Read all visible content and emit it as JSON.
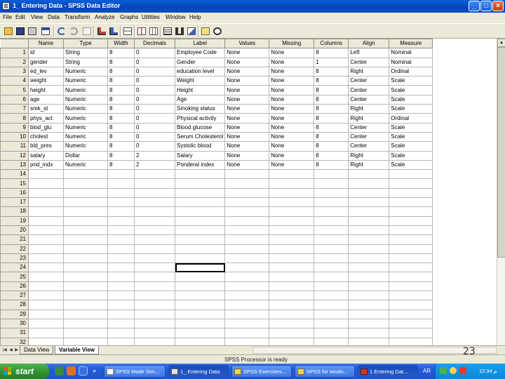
{
  "window": {
    "title": "1_ Entering Data - SPSS Data Editor",
    "minimize": "_",
    "maximize": "□",
    "close": "×"
  },
  "menu": [
    "File",
    "Edit",
    "View",
    "Data",
    "Transform",
    "Analyze",
    "Graphs",
    "Utilities",
    "Window",
    "Help"
  ],
  "toolbar_icons": [
    "open-icon",
    "save-icon",
    "print-icon",
    "dialog-recall-icon",
    "undo-icon",
    "redo-icon",
    "goto-case-icon",
    "variables-icon",
    "find-icon",
    "insert-case-icon",
    "insert-variable-icon",
    "split-file-icon",
    "weight-cases-icon",
    "select-cases-icon",
    "value-labels-icon",
    "use-sets-icon"
  ],
  "grid": {
    "columns": [
      "Name",
      "Type",
      "Width",
      "Decimals",
      "Label",
      "Values",
      "Missing",
      "Columns",
      "Align",
      "Measure"
    ],
    "rows": [
      [
        "id",
        "String",
        "8",
        "0",
        "Employee Code",
        "None",
        "None",
        "8",
        "Left",
        "Nominal"
      ],
      [
        "gender",
        "String",
        "8",
        "0",
        "Gender",
        "None",
        "None",
        "1",
        "Center",
        "Nominal"
      ],
      [
        "ed_lev",
        "Numeric",
        "8",
        "0",
        "education level",
        "None",
        "None",
        "8",
        "Right",
        "Ordinal"
      ],
      [
        "weight",
        "Numeric",
        "8",
        "0",
        "Weight",
        "None",
        "None",
        "8",
        "Center",
        "Scale"
      ],
      [
        "height",
        "Numeric",
        "8",
        "0",
        "Height",
        "None",
        "None",
        "8",
        "Center",
        "Scale"
      ],
      [
        "age",
        "Numeric",
        "8",
        "0",
        "Age",
        "None",
        "None",
        "8",
        "Center",
        "Scale"
      ],
      [
        "smk_st",
        "Numeric",
        "8",
        "0",
        "Smoking status",
        "None",
        "None",
        "8",
        "Right",
        "Scale"
      ],
      [
        "phys_act",
        "Numeric",
        "8",
        "0",
        "Physical activity",
        "None",
        "None",
        "8",
        "Right",
        "Ordinal"
      ],
      [
        "blod_glu",
        "Numeric",
        "8",
        "0",
        "Blood glucose",
        "None",
        "None",
        "8",
        "Center",
        "Scale"
      ],
      [
        "cholest",
        "Numeric",
        "8",
        "0",
        "Serum Cholesterol",
        "None",
        "None",
        "8",
        "Center",
        "Scale"
      ],
      [
        "bld_pres",
        "Numeric",
        "8",
        "0",
        "Systolic blood",
        "None",
        "None",
        "8",
        "Center",
        "Scale"
      ],
      [
        "salary",
        "Dollar",
        "8",
        "2",
        "Salary",
        "None",
        "None",
        "8",
        "Right",
        "Scale"
      ],
      [
        "pnd_indx",
        "Numeric",
        "8",
        "2",
        "Ponderal index",
        "None",
        "None",
        "8",
        "Right",
        "Scale"
      ]
    ],
    "row_numbers": [
      "1",
      "2",
      "3",
      "4",
      "5",
      "6",
      "7",
      "8",
      "9",
      "10",
      "11",
      "12",
      "13",
      "14",
      "15",
      "16",
      "17",
      "18",
      "19",
      "20",
      "21",
      "22",
      "23",
      "24",
      "25",
      "26",
      "27",
      "28",
      "29",
      "30",
      "31",
      "32"
    ]
  },
  "tabs": {
    "data_view": "Data View",
    "variable_view": "Variable View"
  },
  "status": "SPSS Processor  is ready",
  "page_number": "23",
  "taskbar": {
    "start": "start",
    "more": "»",
    "buttons": [
      "SPSS Made Sim...",
      "1_ Entering Data",
      "SPSS Exercises...",
      "SPSS for windo...",
      "1 Entering Dat..."
    ],
    "lang": "AR",
    "clock": "12:34 م"
  }
}
